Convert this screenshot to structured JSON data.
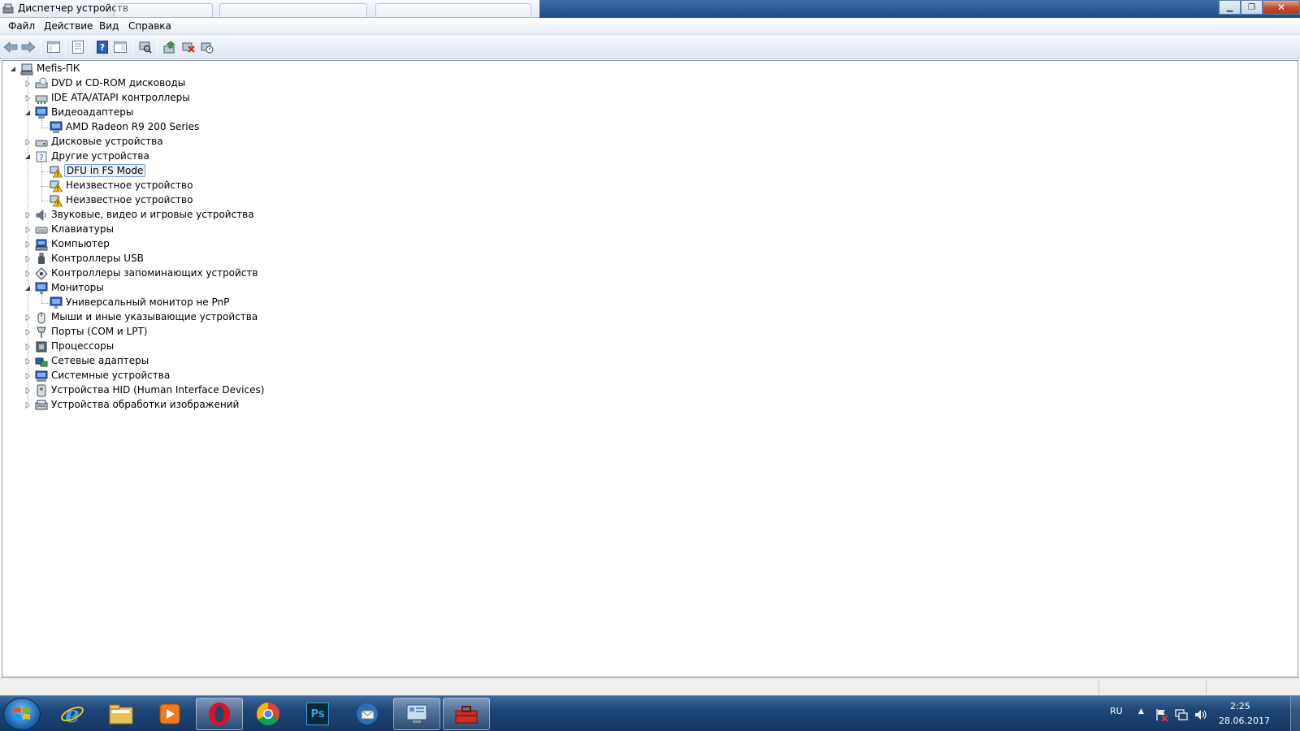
{
  "window": {
    "title": "Диспетчер устройств"
  },
  "menu": {
    "file": "Файл",
    "action": "Действие",
    "view": "Вид",
    "help": "Справка"
  },
  "toolbar_icons": [
    "back-arrow-icon",
    "forward-arrow-icon",
    "show-hide-console-tree-icon",
    "properties-icon",
    "help-icon",
    "view-icon",
    "scan-hardware-icon",
    "update-driver-icon",
    "uninstall-icon",
    "disable-device-icon"
  ],
  "tree": {
    "root": "Mefis-ПК",
    "items": [
      {
        "label": "DVD и CD-ROM дисководы",
        "icon": "dvd-drive-icon"
      },
      {
        "label": "IDE ATA/ATAPI контроллеры",
        "icon": "ide-controller-icon"
      },
      {
        "label": "Видеоадаптеры",
        "icon": "display-adapter-icon",
        "expanded": true
      },
      {
        "label": "AMD Radeon R9 200 Series",
        "icon": "display-adapter-icon",
        "child": true
      },
      {
        "label": "Дисковые устройства",
        "icon": "disk-drive-icon"
      },
      {
        "label": "Другие устройства",
        "icon": "unknown-device-icon",
        "expanded": true
      },
      {
        "label": "DFU in FS Mode",
        "icon": "warning-device-icon",
        "child": true,
        "selected": true
      },
      {
        "label": "Неизвестное устройство",
        "icon": "warning-device-icon",
        "child": true
      },
      {
        "label": "Неизвестное устройство",
        "icon": "warning-device-icon",
        "child": true
      },
      {
        "label": "Звуковые, видео и игровые устройства",
        "icon": "speaker-icon"
      },
      {
        "label": "Клавиатуры",
        "icon": "keyboard-icon"
      },
      {
        "label": "Компьютер",
        "icon": "computer-icon"
      },
      {
        "label": "Контроллеры USB",
        "icon": "usb-icon"
      },
      {
        "label": "Контроллеры запоминающих устройств",
        "icon": "storage-controller-icon"
      },
      {
        "label": "Мониторы",
        "icon": "monitor-icon",
        "expanded": true
      },
      {
        "label": "Универсальный монитор не PnP",
        "icon": "monitor-icon",
        "child": true
      },
      {
        "label": "Мыши и иные указывающие устройства",
        "icon": "mouse-icon"
      },
      {
        "label": "Порты (COM и LPT)",
        "icon": "port-icon"
      },
      {
        "label": "Процессоры",
        "icon": "processor-icon"
      },
      {
        "label": "Сетевые адаптеры",
        "icon": "network-adapter-icon"
      },
      {
        "label": "Системные устройства",
        "icon": "system-device-icon"
      },
      {
        "label": "Устройства HID (Human Interface Devices)",
        "icon": "hid-icon"
      },
      {
        "label": "Устройства обработки изображений",
        "icon": "imaging-device-icon"
      }
    ]
  },
  "taskbar": {
    "apps": [
      "internet-explorer-icon",
      "file-explorer-icon",
      "media-player-icon",
      "opera-icon",
      "chrome-icon",
      "photoshop-icon",
      "thunderbird-icon",
      "control-panel-icon",
      "device-manager-icon"
    ],
    "photoshop_label": "Ps",
    "language": "RU",
    "time": "2:25",
    "date": "28.06.2017"
  },
  "colors": {
    "accent": "#1d4577",
    "selection": "#e8f1fb",
    "warning": "#f2c40d"
  }
}
